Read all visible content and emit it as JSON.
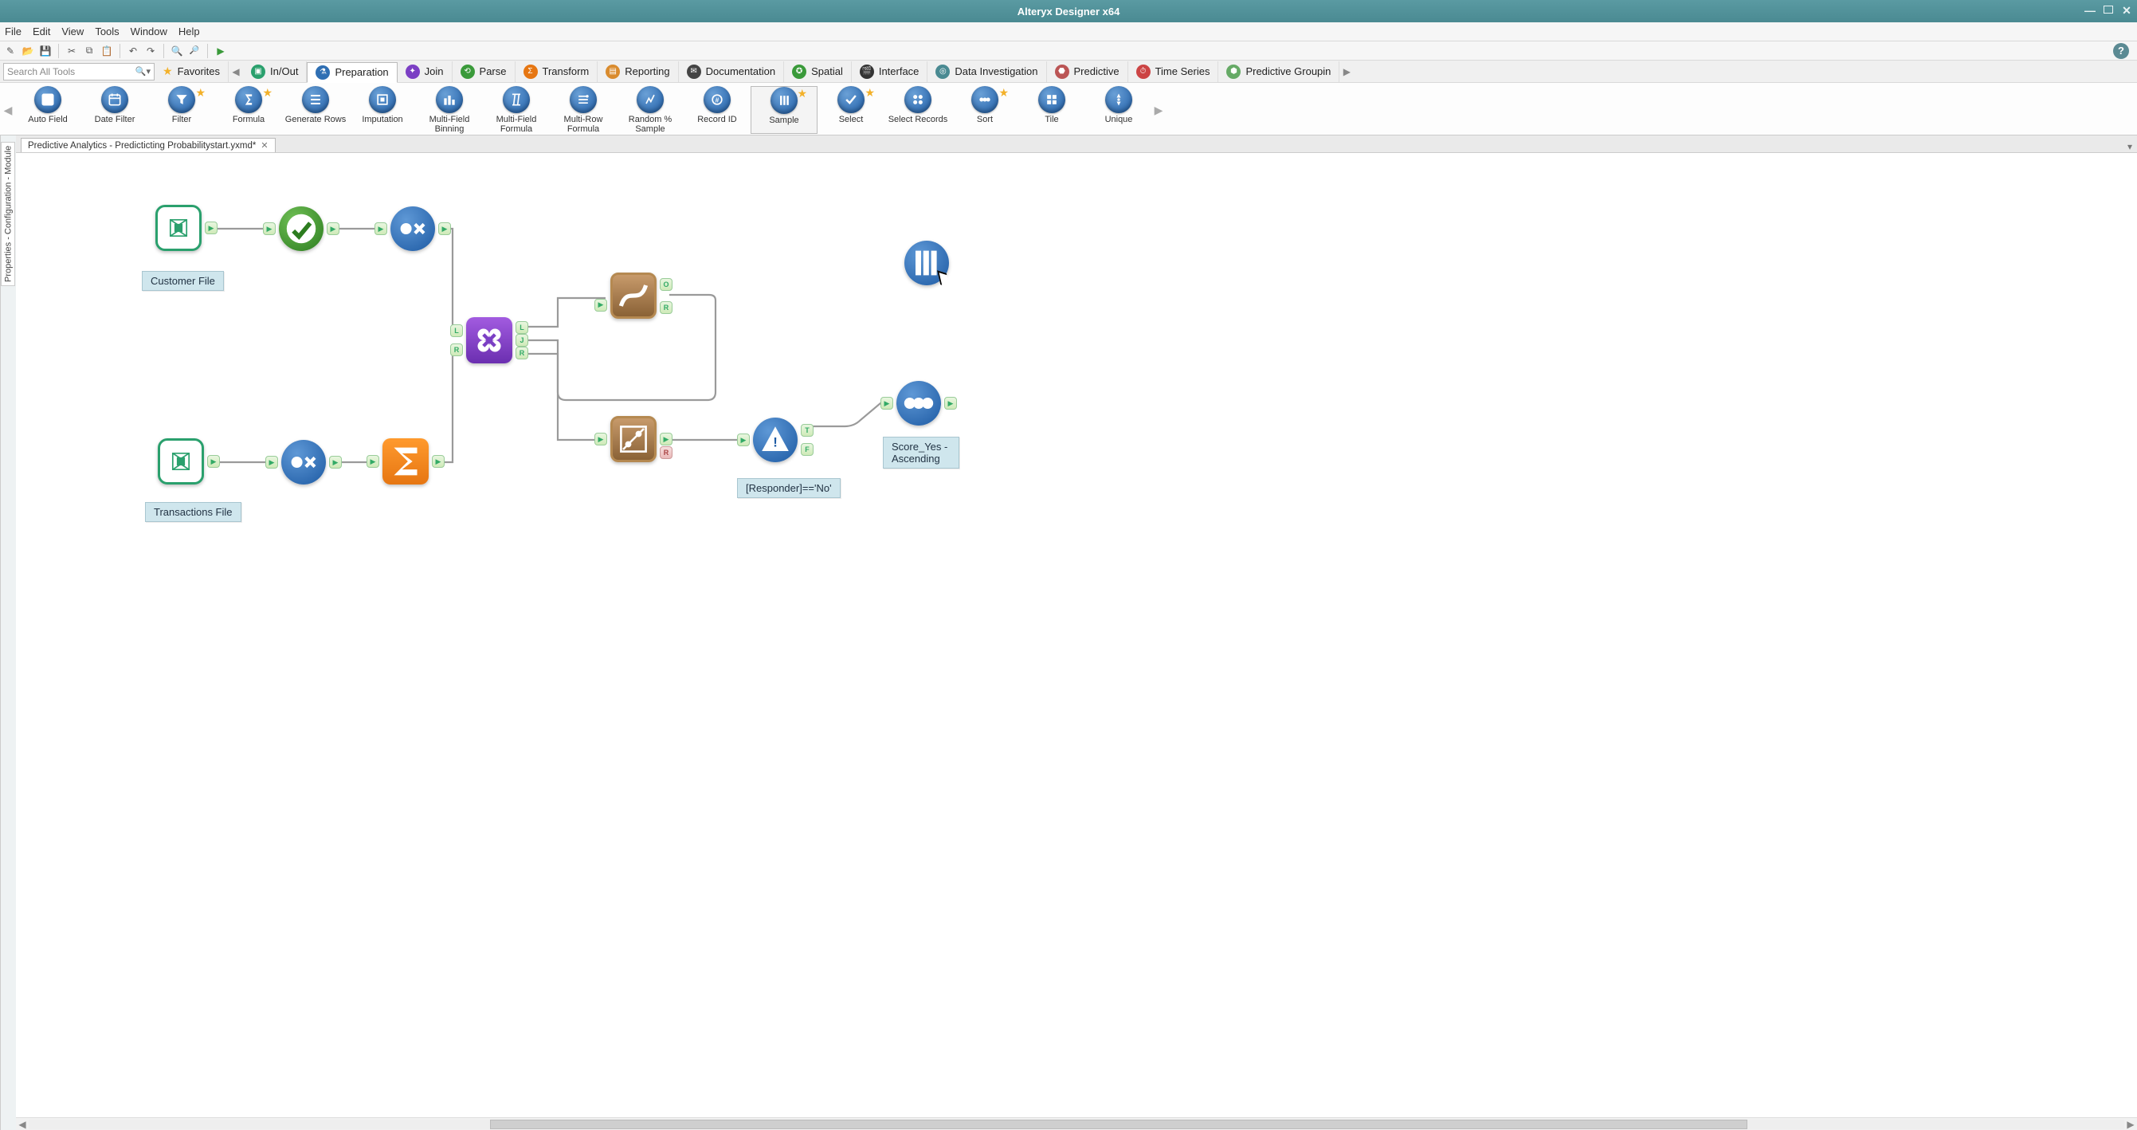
{
  "window": {
    "title": "Alteryx Designer x64"
  },
  "menu": {
    "file": "File",
    "edit": "Edit",
    "view": "View",
    "tools": "Tools",
    "window": "Window",
    "help": "Help"
  },
  "search": {
    "placeholder": "Search All Tools"
  },
  "categories": {
    "favorites": "Favorites",
    "in_out": "In/Out",
    "preparation": "Preparation",
    "join": "Join",
    "parse": "Parse",
    "transform": "Transform",
    "reporting": "Reporting",
    "documentation": "Documentation",
    "spatial": "Spatial",
    "interface": "Interface",
    "data_investigation": "Data Investigation",
    "predictive": "Predictive",
    "time_series": "Time Series",
    "predictive_grouping": "Predictive Groupin"
  },
  "palette": {
    "auto_field": "Auto Field",
    "date_filter": "Date Filter",
    "filter": "Filter",
    "formula": "Formula",
    "generate_rows": "Generate Rows",
    "imputation": "Imputation",
    "multi_field_binning": "Multi-Field Binning",
    "multi_field_formula": "Multi-Field Formula",
    "multi_row_formula": "Multi-Row Formula",
    "random_sample": "Random % Sample",
    "record_id": "Record ID",
    "sample": "Sample",
    "select": "Select",
    "select_records": "Select Records",
    "sort": "Sort",
    "tile": "Tile",
    "unique": "Unique"
  },
  "document": {
    "tab_title": "Predictive Analytics - Predicticting Probabilitystart.yxmd*"
  },
  "side_panels": {
    "properties": "Properties - Configuration - Module"
  },
  "canvas": {
    "annotations": {
      "customer_file": "Customer File",
      "transactions_file": "Transactions File",
      "filter_expr": "[Responder]=='No'",
      "sort_expr": "Score_Yes - Ascending"
    },
    "join_ports": {
      "l": "L",
      "j": "J",
      "r": "R"
    },
    "score_ports": {
      "o": "O",
      "r": "R"
    },
    "filter_ports": {
      "t": "T",
      "f": "F"
    }
  }
}
